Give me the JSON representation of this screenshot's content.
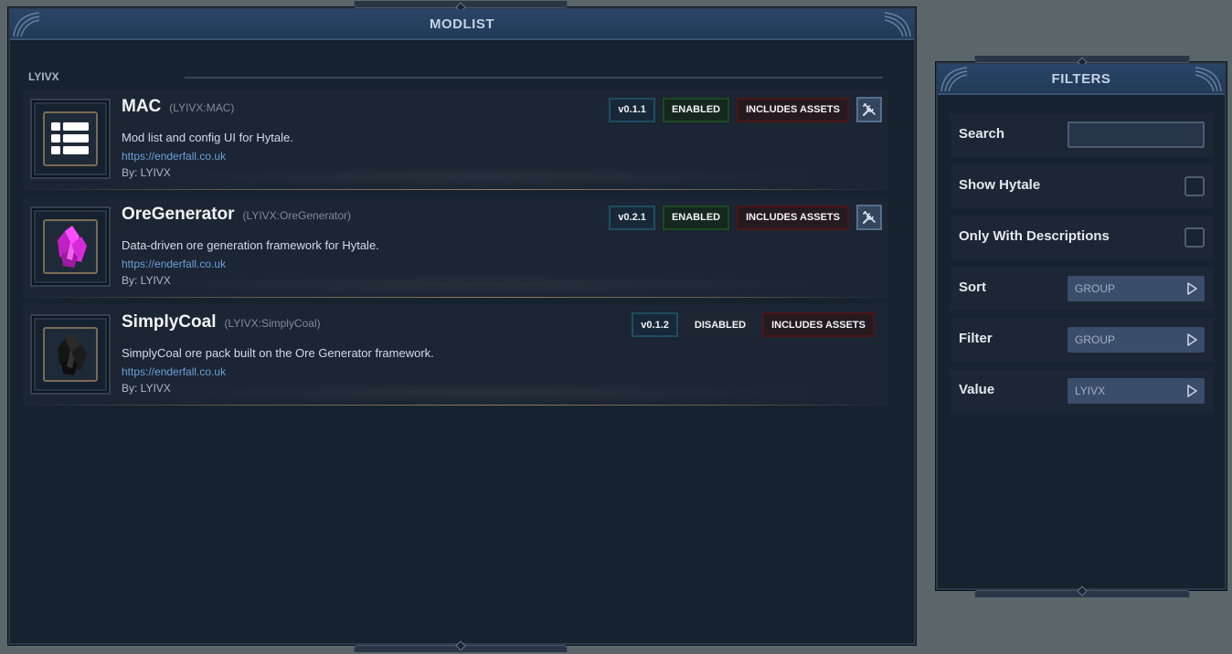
{
  "modlist": {
    "title": "MODLIST",
    "group_label": "LYIVX",
    "mods": [
      {
        "name": "MAC",
        "id": "(LYIVX:MAC)",
        "description": "Mod list and config UI for Hytale.",
        "link": "https://enderfall.co.uk",
        "author": "By: LYIVX",
        "version": "v0.1.1",
        "status": "ENABLED",
        "assets": "INCLUDES ASSETS",
        "icon": "list-icon",
        "has_config": true
      },
      {
        "name": "OreGenerator",
        "id": "(LYIVX:OreGenerator)",
        "description": "Data-driven ore generation framework for Hytale.",
        "link": "https://enderfall.co.uk",
        "author": "By: LYIVX",
        "version": "v0.2.1",
        "status": "ENABLED",
        "assets": "INCLUDES ASSETS",
        "icon": "magenta-crystal-icon",
        "has_config": true
      },
      {
        "name": "SimplyCoal",
        "id": "(LYIVX:SimplyCoal)",
        "description": "SimplyCoal ore pack built on the Ore Generator framework.",
        "link": "https://enderfall.co.uk",
        "author": "By: LYIVX",
        "version": "v0.1.2",
        "status": "DISABLED",
        "assets": "INCLUDES ASSETS",
        "icon": "coal-crystal-icon",
        "has_config": false
      }
    ]
  },
  "filters": {
    "title": "FILTERS",
    "search": {
      "label": "Search",
      "value": ""
    },
    "show_hytale": {
      "label": "Show Hytale",
      "checked": false
    },
    "only_descriptions": {
      "label": "Only With Descriptions",
      "checked": false
    },
    "sort": {
      "label": "Sort",
      "value": "GROUP"
    },
    "filter": {
      "label": "Filter",
      "value": "GROUP"
    },
    "value": {
      "label": "Value",
      "value": "LYIVX"
    }
  },
  "colors": {
    "enabled_border": "#1c4a24",
    "assets_border": "#4d1417",
    "version_border": "#1e4d62",
    "link": "#6d9fd9",
    "header": "#213a58"
  }
}
